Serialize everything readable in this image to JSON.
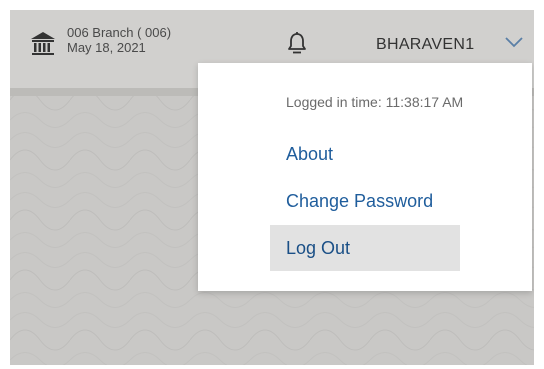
{
  "header": {
    "branch_name": "006 Branch ( 006)",
    "branch_date": "May 18, 2021",
    "username": "BHARAVEN1"
  },
  "dropdown": {
    "logged_in_text": "Logged in time: 11:38:17 AM",
    "items": [
      {
        "label": "About"
      },
      {
        "label": "Change Password"
      },
      {
        "label": "Log Out",
        "highlighted": true
      }
    ]
  },
  "colors": {
    "accent": "#1f5d9c",
    "header_bg": "#d1d0ce",
    "body_bg": "#c9c8c6",
    "highlight_bg": "#e2e2e2"
  }
}
